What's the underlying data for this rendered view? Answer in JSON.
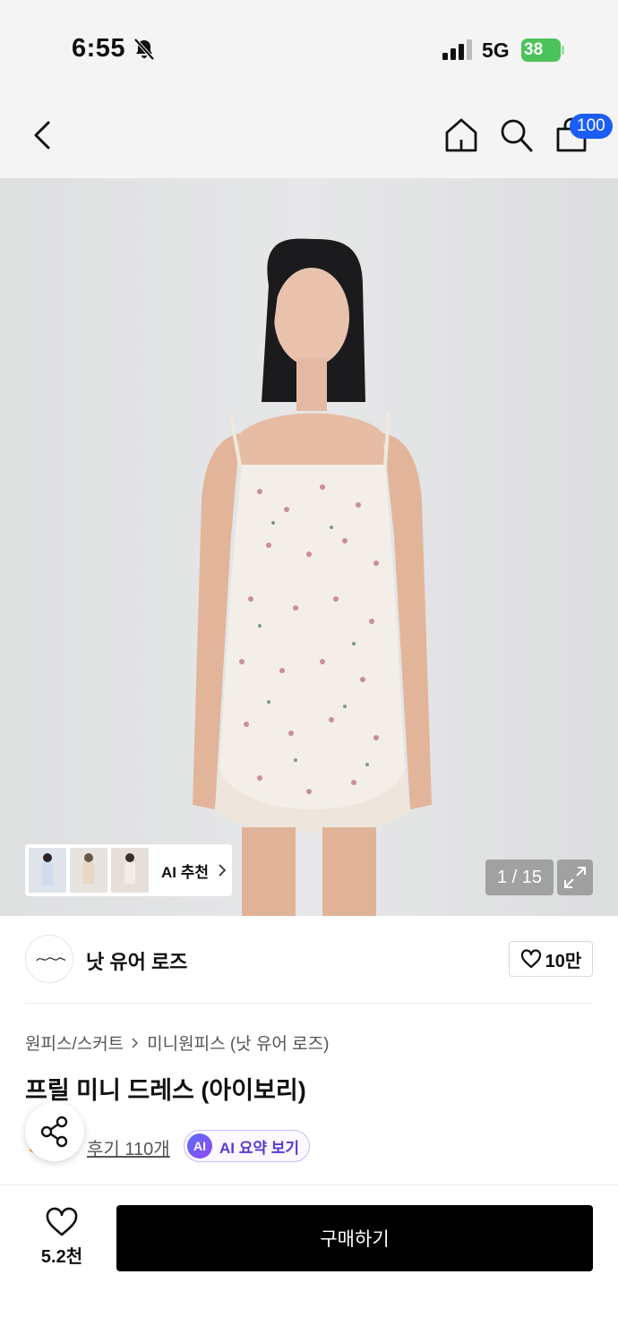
{
  "status_bar": {
    "time": "6:55",
    "network": "5G",
    "battery": "38"
  },
  "nav": {
    "cart_badge": "100"
  },
  "gallery": {
    "ai_rec_label": "AI 추천",
    "page_counter": "1 / 15"
  },
  "brand": {
    "name": "낫 유어 로즈",
    "likes": "10만"
  },
  "breadcrumb": {
    "category": "원피스/스커트",
    "subcategory": "미니원피스 (낫 유어 로즈)"
  },
  "product": {
    "title": "프릴 미니 드레스 (아이보리)"
  },
  "reviews": {
    "link_label": "후기 110개",
    "ai_badge": "AI",
    "ai_summary_label": "AI 요약 보기"
  },
  "bottom_bar": {
    "wish_count": "5.2천",
    "buy_label": "구매하기"
  },
  "colors": {
    "cart_badge": "#1a5df7",
    "buy_button": "#000000",
    "ai_summary_text": "#5a38d6",
    "battery": "#4cc25a"
  }
}
